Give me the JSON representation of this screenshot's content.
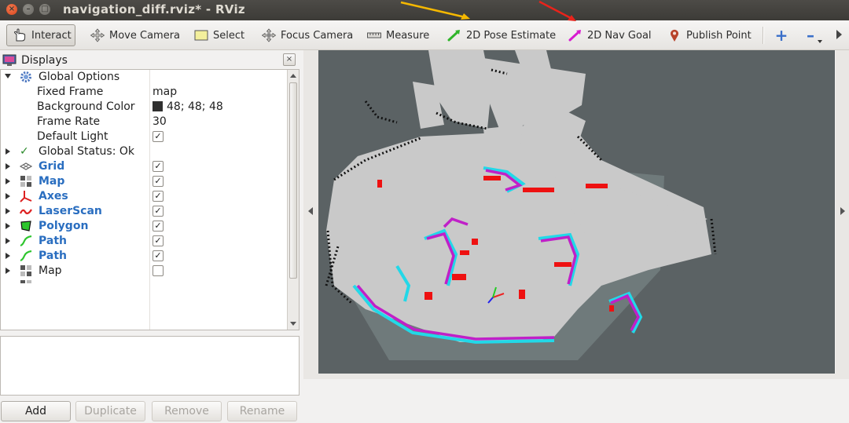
{
  "window": {
    "title": "navigation_diff.rviz* - RViz",
    "close_glyph": "×",
    "minimize_glyph": "–",
    "maximize_glyph": "□"
  },
  "toolbar": {
    "interact": "Interact",
    "move_camera": "Move Camera",
    "select": "Select",
    "focus_camera": "Focus Camera",
    "measure": "Measure",
    "pose_estimate": "2D Pose Estimate",
    "nav_goal": "2D Nav Goal",
    "publish_point": "Publish Point",
    "add_tool_glyph": "+",
    "remove_tool_glyph": "–"
  },
  "displays": {
    "title": "Displays",
    "close_glyph": "×",
    "global_options": "Global Options",
    "fixed_frame_label": "Fixed Frame",
    "fixed_frame_value": "map",
    "background_color_label": "Background Color",
    "background_color_value": "48; 48; 48",
    "frame_rate_label": "Frame Rate",
    "frame_rate_value": "30",
    "default_light_label": "Default Light",
    "global_status": "Global Status: Ok",
    "items": [
      {
        "label": "Grid"
      },
      {
        "label": "Map"
      },
      {
        "label": "Axes"
      },
      {
        "label": "LaserScan"
      },
      {
        "label": "Polygon"
      },
      {
        "label": "Path"
      },
      {
        "label": "Path"
      },
      {
        "label": "Map"
      }
    ],
    "check_glyph": "✓"
  },
  "buttons": {
    "add": "Add",
    "duplicate": "Duplicate",
    "remove": "Remove",
    "rename": "Rename"
  },
  "colors": {
    "annotation_arrow_orange": "#f5b800",
    "annotation_arrow_red": "#e8231b",
    "obstacle_red": "#ee1111",
    "inflation_magenta": "#c020c8",
    "inflation_cyan": "#22d8e8",
    "free_space": "#c8c8c8",
    "viewport_background": "#5b6264"
  }
}
